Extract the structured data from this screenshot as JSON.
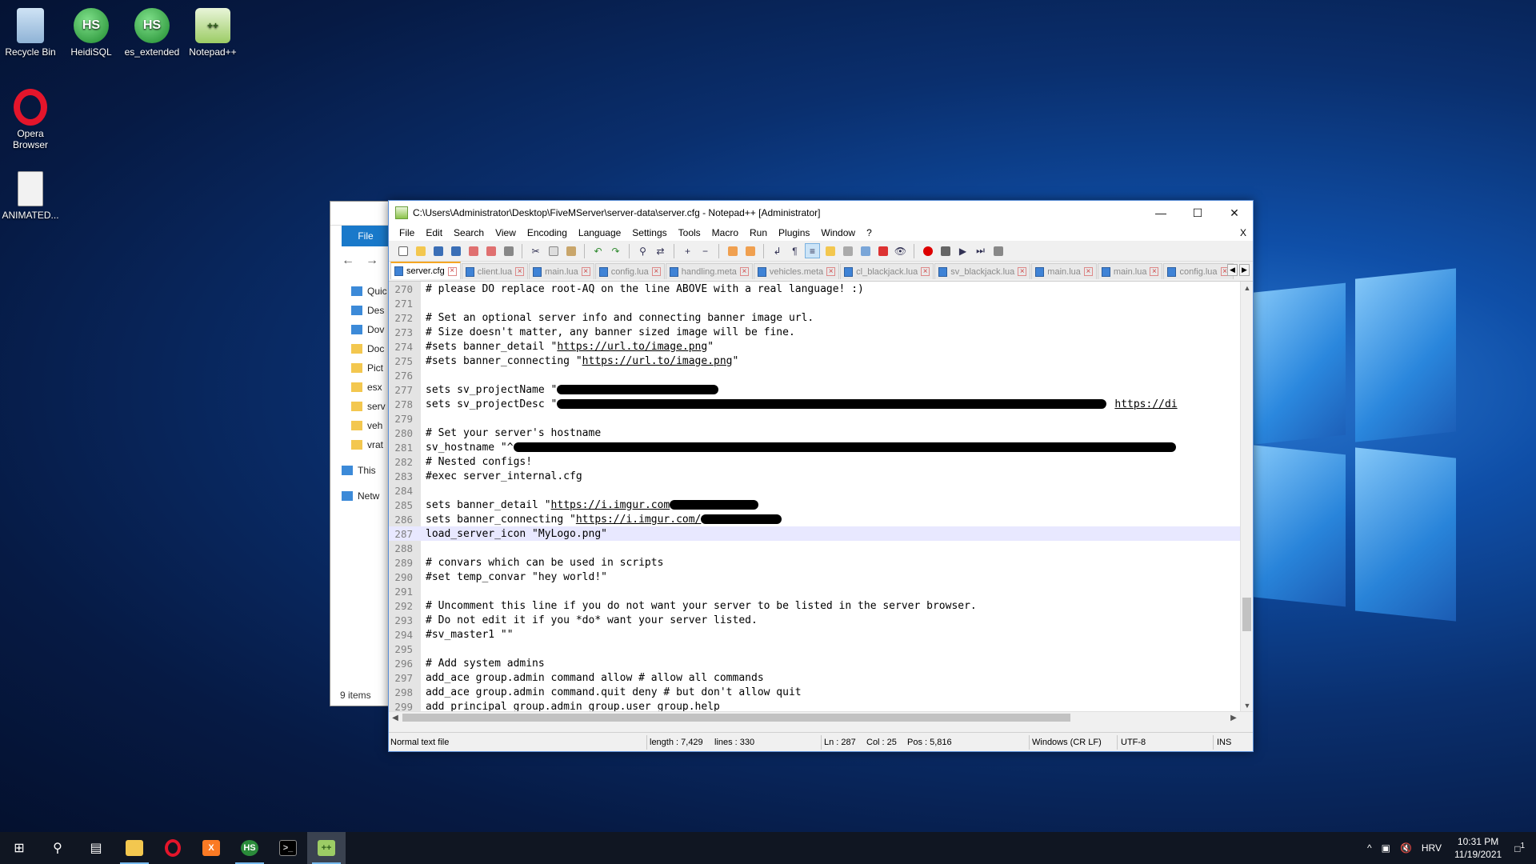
{
  "desktop": {
    "icons": [
      {
        "label": "Recycle Bin",
        "icon": "recycle-bin-icon"
      },
      {
        "label": "HeidiSQL",
        "icon": "heidisql-icon",
        "glyph": "HS"
      },
      {
        "label": "es_extended",
        "icon": "heidisql-icon",
        "glyph": "HS"
      },
      {
        "label": "Notepad++",
        "icon": "notepad-plus-plus-icon"
      },
      {
        "label": "Opera Browser",
        "icon": "opera-icon"
      },
      {
        "label": "ANIMATED...",
        "icon": "document-icon"
      }
    ]
  },
  "explorer": {
    "file_tab": "File",
    "tree": [
      "Quic",
      "Des",
      "Dov",
      "Doc",
      "Pict",
      "esx",
      "serv",
      "veh",
      "vrat",
      "This",
      "Netw"
    ],
    "item_count": "9 items"
  },
  "npp": {
    "title": "C:\\Users\\Administrator\\Desktop\\FiveMServer\\server-data\\server.cfg - Notepad++ [Administrator]",
    "menu": [
      "File",
      "Edit",
      "Search",
      "View",
      "Encoding",
      "Language",
      "Settings",
      "Tools",
      "Macro",
      "Run",
      "Plugins",
      "Window",
      "?"
    ],
    "menu_close": "X",
    "tabs": [
      "server.cfg",
      "client.lua",
      "main.lua",
      "config.lua",
      "handling.meta",
      "vehicles.meta",
      "cl_blackjack.lua",
      "sv_blackjack.lua",
      "main.lua",
      "main.lua",
      "config.lua"
    ],
    "active_tab": 0,
    "lines": [
      {
        "n": "270",
        "text": "# please DO replace root-AQ on the line ABOVE with a real language! :)"
      },
      {
        "n": "271",
        "text": ""
      },
      {
        "n": "272",
        "text": "# Set an optional server info and connecting banner image url."
      },
      {
        "n": "273",
        "text": "# Size doesn't matter, any banner sized image will be fine."
      },
      {
        "n": "274",
        "pre": "#sets banner_detail \"",
        "url": "https://url.to/image.png",
        "post": "\""
      },
      {
        "n": "275",
        "pre": "#sets banner_connecting \"",
        "url": "https://url.to/image.png",
        "post": "\""
      },
      {
        "n": "276",
        "text": ""
      },
      {
        "n": "277",
        "pre": "sets sv_projectName \"",
        "redact": 0.2
      },
      {
        "n": "278",
        "pre": "sets sv_projectDesc \"",
        "redact": 0.68,
        "trail_url": "https://di"
      },
      {
        "n": "279",
        "text": ""
      },
      {
        "n": "280",
        "text": "# Set your server's hostname"
      },
      {
        "n": "281",
        "pre": "sv_hostname \"^",
        "redact": 0.82
      },
      {
        "n": "282",
        "text": "# Nested configs!"
      },
      {
        "n": "283",
        "text": "#exec server_internal.cfg"
      },
      {
        "n": "284",
        "text": ""
      },
      {
        "n": "285",
        "pre": "sets banner_detail \"",
        "url": "https://i.imgur.com",
        "redact": 0.11
      },
      {
        "n": "286",
        "pre": "sets banner_connecting \"",
        "url": "https://i.imgur.com/",
        "redact": 0.1
      },
      {
        "n": "287",
        "text": "load_server_icon \"MyLogo.png\"",
        "current": true
      },
      {
        "n": "288",
        "text": ""
      },
      {
        "n": "289",
        "text": "# convars which can be used in scripts"
      },
      {
        "n": "290",
        "text": "#set temp_convar \"hey world!\""
      },
      {
        "n": "291",
        "text": ""
      },
      {
        "n": "292",
        "text": "# Uncomment this line if you do not want your server to be listed in the server browser."
      },
      {
        "n": "293",
        "text": "# Do not edit it if you *do* want your server listed."
      },
      {
        "n": "294",
        "text": "#sv_master1 \"\""
      },
      {
        "n": "295",
        "text": ""
      },
      {
        "n": "296",
        "text": "# Add system admins"
      },
      {
        "n": "297",
        "text": "add_ace group.admin command allow # allow all commands"
      },
      {
        "n": "298",
        "text": "add_ace group.admin command.quit deny # but don't allow quit"
      },
      {
        "n": "299",
        "text": "add_principal group.admin group.user group.help"
      }
    ],
    "status": {
      "type": "Normal text file",
      "length": "length : 7,429",
      "lines": "lines : 330",
      "ln": "Ln : 287",
      "col": "Col : 25",
      "pos": "Pos : 5,816",
      "eol": "Windows (CR LF)",
      "encoding": "UTF-8",
      "mode": "INS"
    }
  },
  "taskbar": {
    "apps": [
      "start-icon",
      "search-icon",
      "task-view-icon",
      "file-explorer-icon",
      "opera-icon",
      "xampp-icon",
      "heidisql-icon",
      "terminal-icon",
      "notepad-plus-plus-icon"
    ],
    "lang": "HRV",
    "time": "10:31 PM",
    "date": "11/19/2021",
    "notifications": "1"
  }
}
